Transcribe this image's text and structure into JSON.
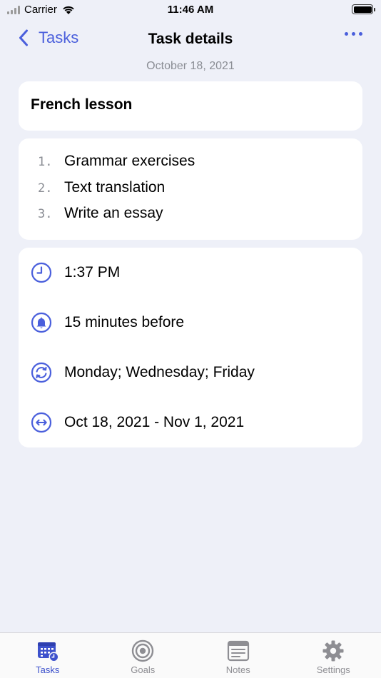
{
  "status_bar": {
    "carrier": "Carrier",
    "time": "11:46 AM"
  },
  "nav": {
    "back_label": "Tasks",
    "title": "Task details"
  },
  "date": "October 18, 2021",
  "task": {
    "title": "French lesson",
    "subtasks": [
      {
        "number": "1.",
        "text": "Grammar exercises"
      },
      {
        "number": "2.",
        "text": "Text translation"
      },
      {
        "number": "3.",
        "text": "Write an essay"
      }
    ],
    "time": "1:37 PM",
    "reminder": "15 minutes before",
    "repeat": "Monday; Wednesday; Friday",
    "period": "Oct 18, 2021 - Nov 1, 2021"
  },
  "tabs": [
    {
      "label": "Tasks",
      "icon": "calendar-clock-icon",
      "active": true
    },
    {
      "label": "Goals",
      "icon": "target-icon",
      "active": false
    },
    {
      "label": "Notes",
      "icon": "note-icon",
      "active": false
    },
    {
      "label": "Settings",
      "icon": "gear-icon",
      "active": false
    }
  ],
  "colors": {
    "accent": "#4a5fdc",
    "tab_active": "#3d51cc",
    "background": "#eef0f8"
  }
}
